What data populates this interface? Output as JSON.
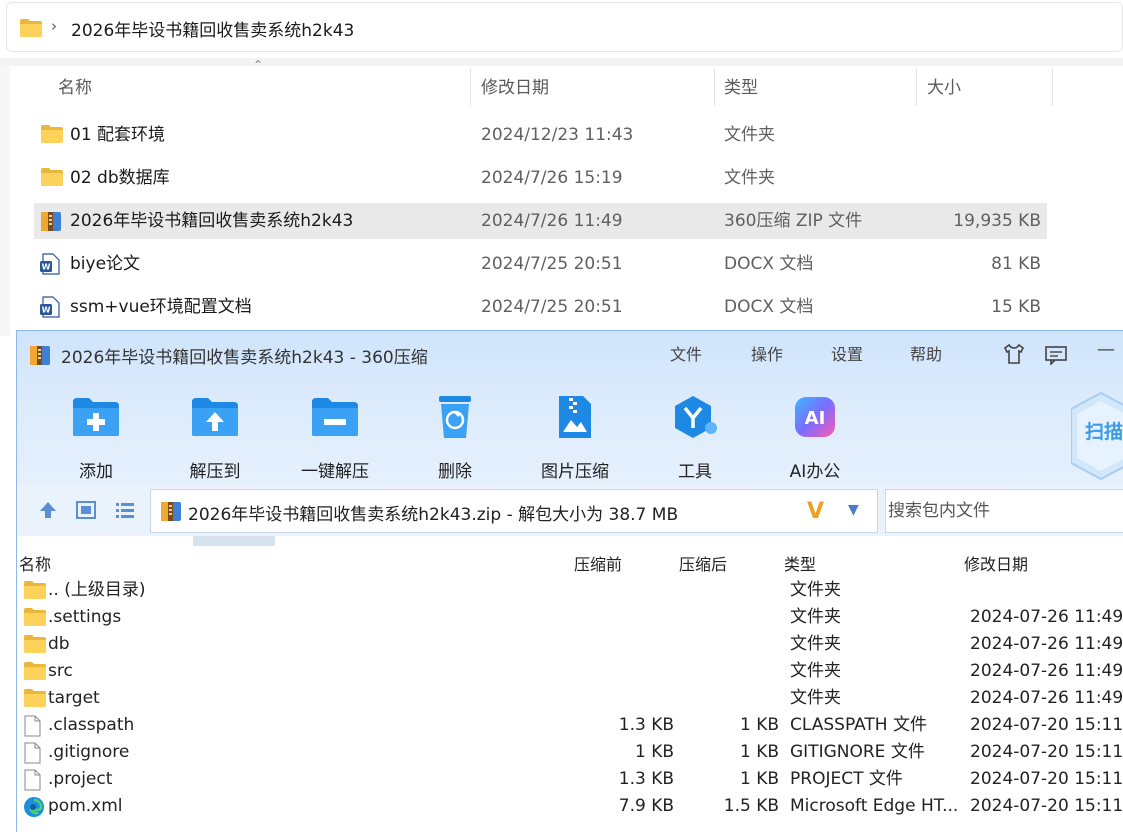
{
  "explorer": {
    "breadcrumb": "2026年毕设书籍回收售卖系统h2k43",
    "columns": {
      "name": "名称",
      "date": "修改日期",
      "type": "类型",
      "size": "大小"
    },
    "rows": [
      {
        "name": "01 配套环境",
        "date": "2024/12/23 11:43",
        "type": "文件夹",
        "size": "",
        "icon": "folder-icon"
      },
      {
        "name": "02 db数据库",
        "date": "2024/7/26 15:19",
        "type": "文件夹",
        "size": "",
        "icon": "folder-icon"
      },
      {
        "name": "2026年毕设书籍回收售卖系统h2k43",
        "date": "2024/7/26 11:49",
        "type": "360压缩 ZIP 文件",
        "size": "19,935 KB",
        "icon": "zip-archive-icon"
      },
      {
        "name": "biye论文",
        "date": "2024/7/25 20:51",
        "type": "DOCX 文档",
        "size": "81 KB",
        "icon": "word-document-icon"
      },
      {
        "name": "ssm+vue环境配置文档",
        "date": "2024/7/25 20:51",
        "type": "DOCX 文档",
        "size": "15 KB",
        "icon": "word-document-icon"
      }
    ]
  },
  "zip": {
    "title": "2026年毕设书籍回收售卖系统h2k43 - 360压缩",
    "menu": [
      "文件",
      "操作",
      "设置",
      "帮助"
    ],
    "toolbar": [
      "添加",
      "解压到",
      "一键解压",
      "删除",
      "图片压缩",
      "工具",
      "AI办公"
    ],
    "scan_label": "扫描",
    "path_text": "2026年毕设书籍回收售卖系统h2k43.zip - 解包大小为 38.7 MB",
    "search_placeholder": "搜索包内文件",
    "columns": {
      "name": "名称",
      "before": "压缩前",
      "after": "压缩后",
      "type": "类型",
      "date": "修改日期"
    },
    "rows": [
      {
        "name": ".. (上级目录)",
        "before": "",
        "after": "",
        "type": "文件夹",
        "date": "",
        "icon": "folder-icon"
      },
      {
        "name": ".settings",
        "before": "",
        "after": "",
        "type": "文件夹",
        "date": "2024-07-26 11:49",
        "icon": "folder-icon"
      },
      {
        "name": "db",
        "before": "",
        "after": "",
        "type": "文件夹",
        "date": "2024-07-26 11:49",
        "icon": "folder-icon"
      },
      {
        "name": "src",
        "before": "",
        "after": "",
        "type": "文件夹",
        "date": "2024-07-26 11:49",
        "icon": "folder-icon"
      },
      {
        "name": "target",
        "before": "",
        "after": "",
        "type": "文件夹",
        "date": "2024-07-26 11:49",
        "icon": "folder-icon"
      },
      {
        "name": ".classpath",
        "before": "1.3 KB",
        "after": "1 KB",
        "type": "CLASSPATH 文件",
        "date": "2024-07-20 15:11",
        "icon": "file-icon"
      },
      {
        "name": ".gitignore",
        "before": "1 KB",
        "after": "1 KB",
        "type": "GITIGNORE 文件",
        "date": "2024-07-20 15:11",
        "icon": "file-icon"
      },
      {
        "name": ".project",
        "before": "1.3 KB",
        "after": "1 KB",
        "type": "PROJECT 文件",
        "date": "2024-07-20 15:11",
        "icon": "file-icon"
      },
      {
        "name": "pom.xml",
        "before": "7.9 KB",
        "after": "1.5 KB",
        "type": "Microsoft Edge HT...",
        "date": "2024-07-20 15:11",
        "icon": "edge-icon"
      }
    ]
  },
  "colors": {
    "accent_blue": "#1e88e5",
    "folder_yellow": "#f5c542",
    "title_bg": "#cfe4fb"
  }
}
